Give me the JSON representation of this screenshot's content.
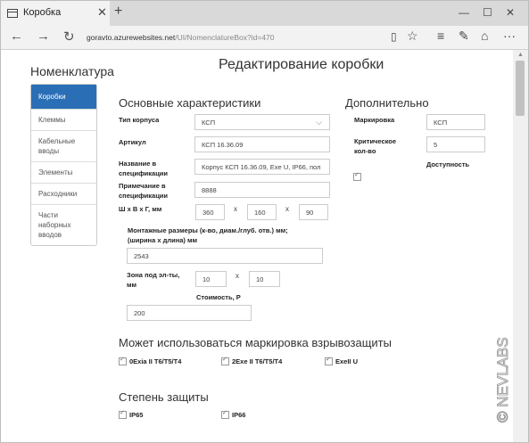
{
  "browser": {
    "tab_title": "Коробка",
    "url_host": "goravto.azurewebsites.net",
    "url_path": "/UI/NomenclatureBox?id=470"
  },
  "sidebar": {
    "title": "Номенклатура",
    "items": [
      {
        "label": "Коробки",
        "active": true
      },
      {
        "label": "Клеммы"
      },
      {
        "label": "Кабельные вводы"
      },
      {
        "label": "Элементы"
      },
      {
        "label": "Расходники"
      },
      {
        "label": "Части наборных вводов"
      }
    ]
  },
  "page_title": "Редактирование коробки",
  "main": {
    "section_title": "Основные характеристики",
    "case_type_label": "Тип корпуса",
    "case_type_value": "КСП",
    "article_label": "Артикул",
    "article_value": "КСП 16.36.09",
    "spec_name_label": "Название в спецификации",
    "spec_name_value": "Корпус КСП 16.36.09, Exe U, IP66, пол",
    "spec_note_label": "Примечание в спецификации",
    "spec_note_value": "8888",
    "dims_label": "Ш х В х Г, мм",
    "dim_w": "360",
    "dim_h": "160",
    "dim_d": "90",
    "dim_sep": "х",
    "mount_label": "Монтажные размеры (к-во, диам./глуб. отв.) мм; (ширина х длина) мм",
    "mount_value": "2543",
    "zone_label": "Зона под эл-ты, мм",
    "zone_a": "10",
    "zone_b": "10",
    "cost_label": "Стоимость, Р",
    "cost_value": "200"
  },
  "extra": {
    "section_title": "Дополнительно",
    "marking_label": "Маркировка",
    "marking_value": "КСП",
    "critical_label": "Критическое кол-во",
    "critical_value": "5",
    "availability_label": "Доступность"
  },
  "explosion": {
    "title": "Может использоваться маркировка взрывозащиты",
    "options": [
      "0Exia II T6/T5/T4",
      "2Exe II T6/T5/T4",
      "ExeII U"
    ]
  },
  "protection": {
    "title": "Степень защиты",
    "options": [
      "IP65",
      "IP66"
    ]
  },
  "watermark": "© NEVLABS"
}
